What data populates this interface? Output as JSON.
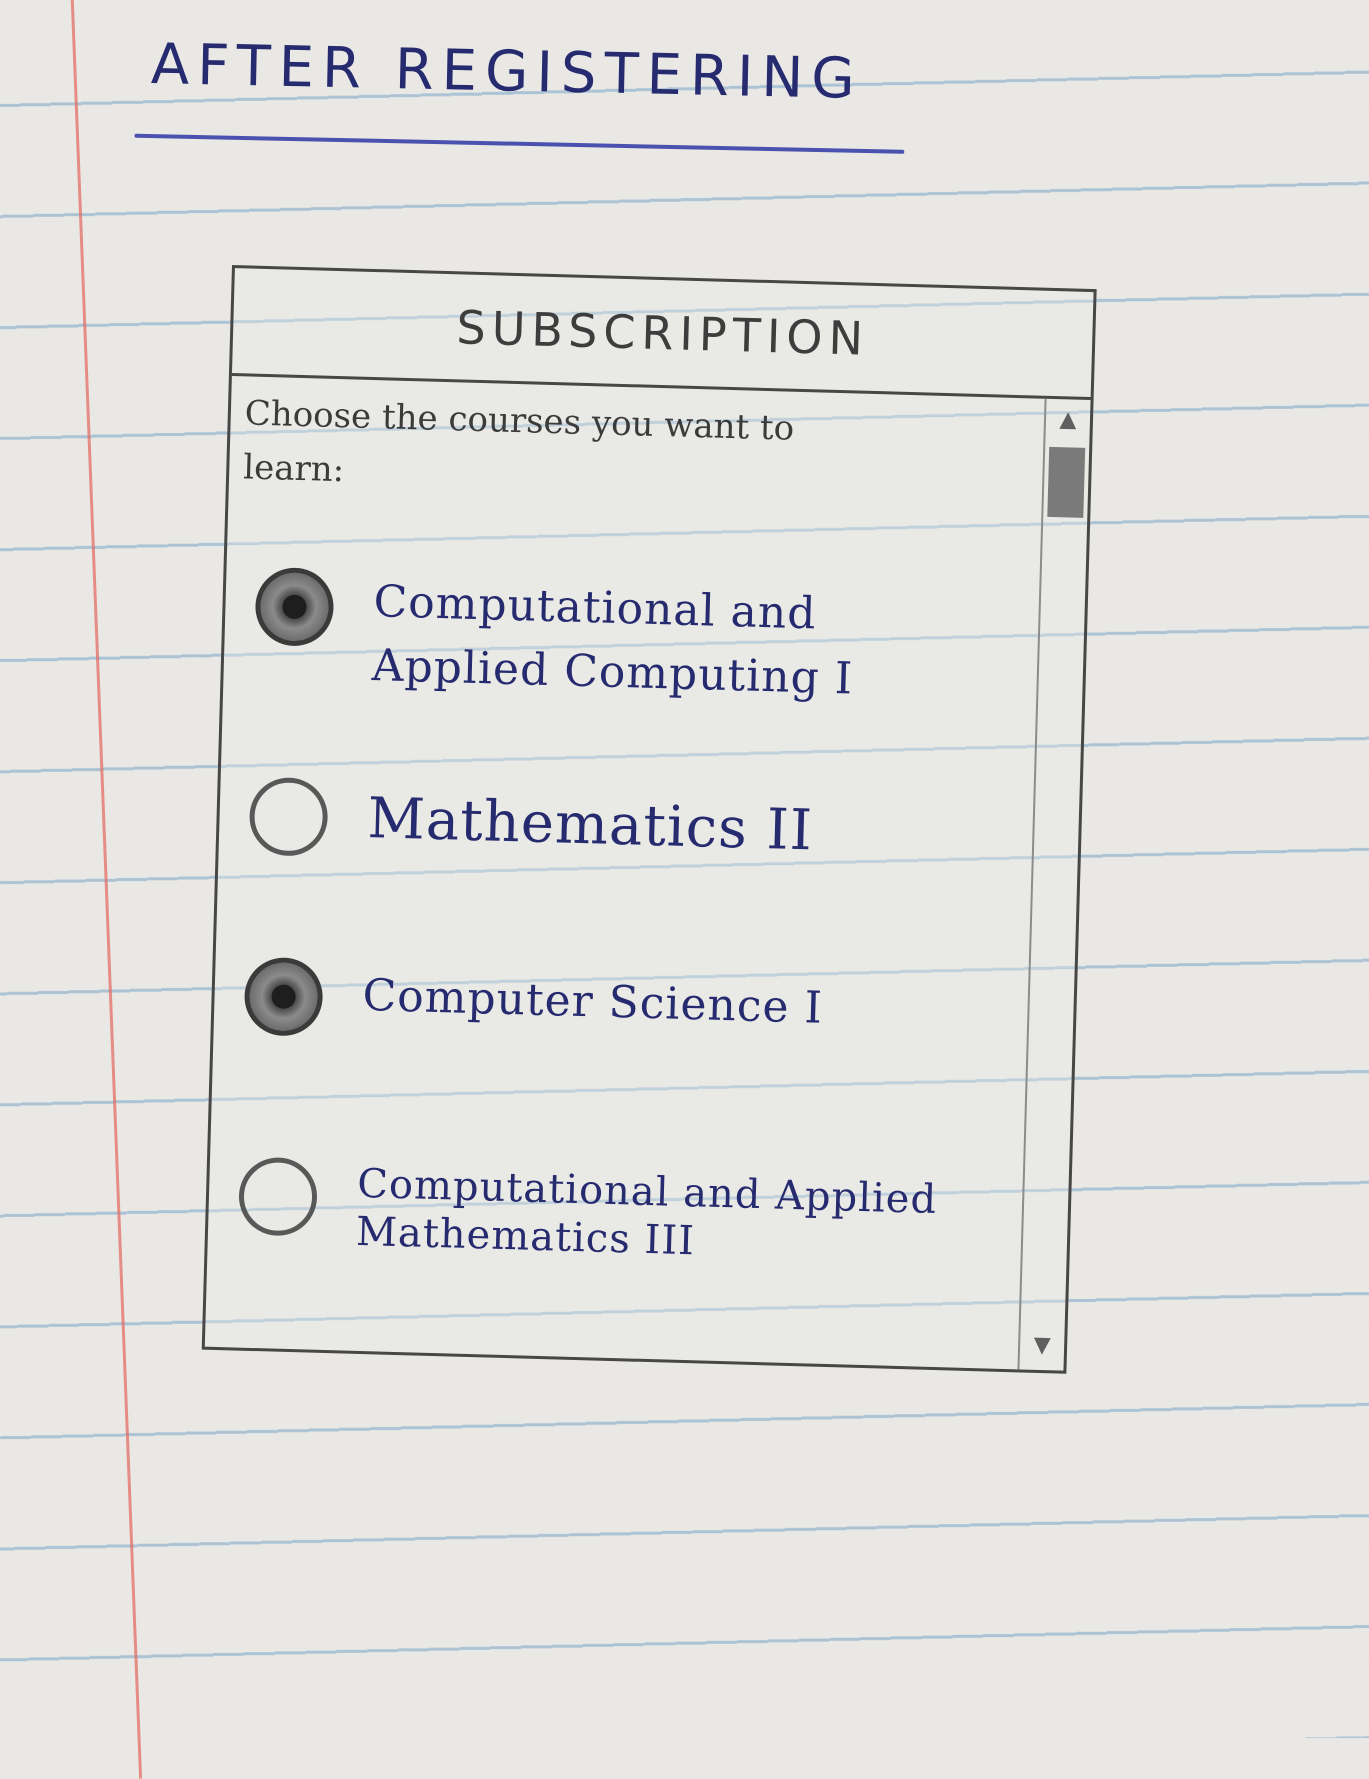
{
  "page": {
    "heading": "AFTER REGISTERING"
  },
  "window": {
    "title": "SUBSCRIPTION",
    "prompt_line1": "Choose the courses you want to",
    "prompt_line2": "learn:"
  },
  "courses": [
    {
      "label": "Computational and Applied Computing I",
      "selected": true
    },
    {
      "label": "Mathematics II",
      "selected": false
    },
    {
      "label": "Computer Science I",
      "selected": true
    },
    {
      "label": "Computational and Applied Mathematics III",
      "selected": false
    }
  ],
  "scrollbar": {
    "up_icon": "scroll-up-arrow",
    "down_icon": "scroll-down-arrow"
  }
}
